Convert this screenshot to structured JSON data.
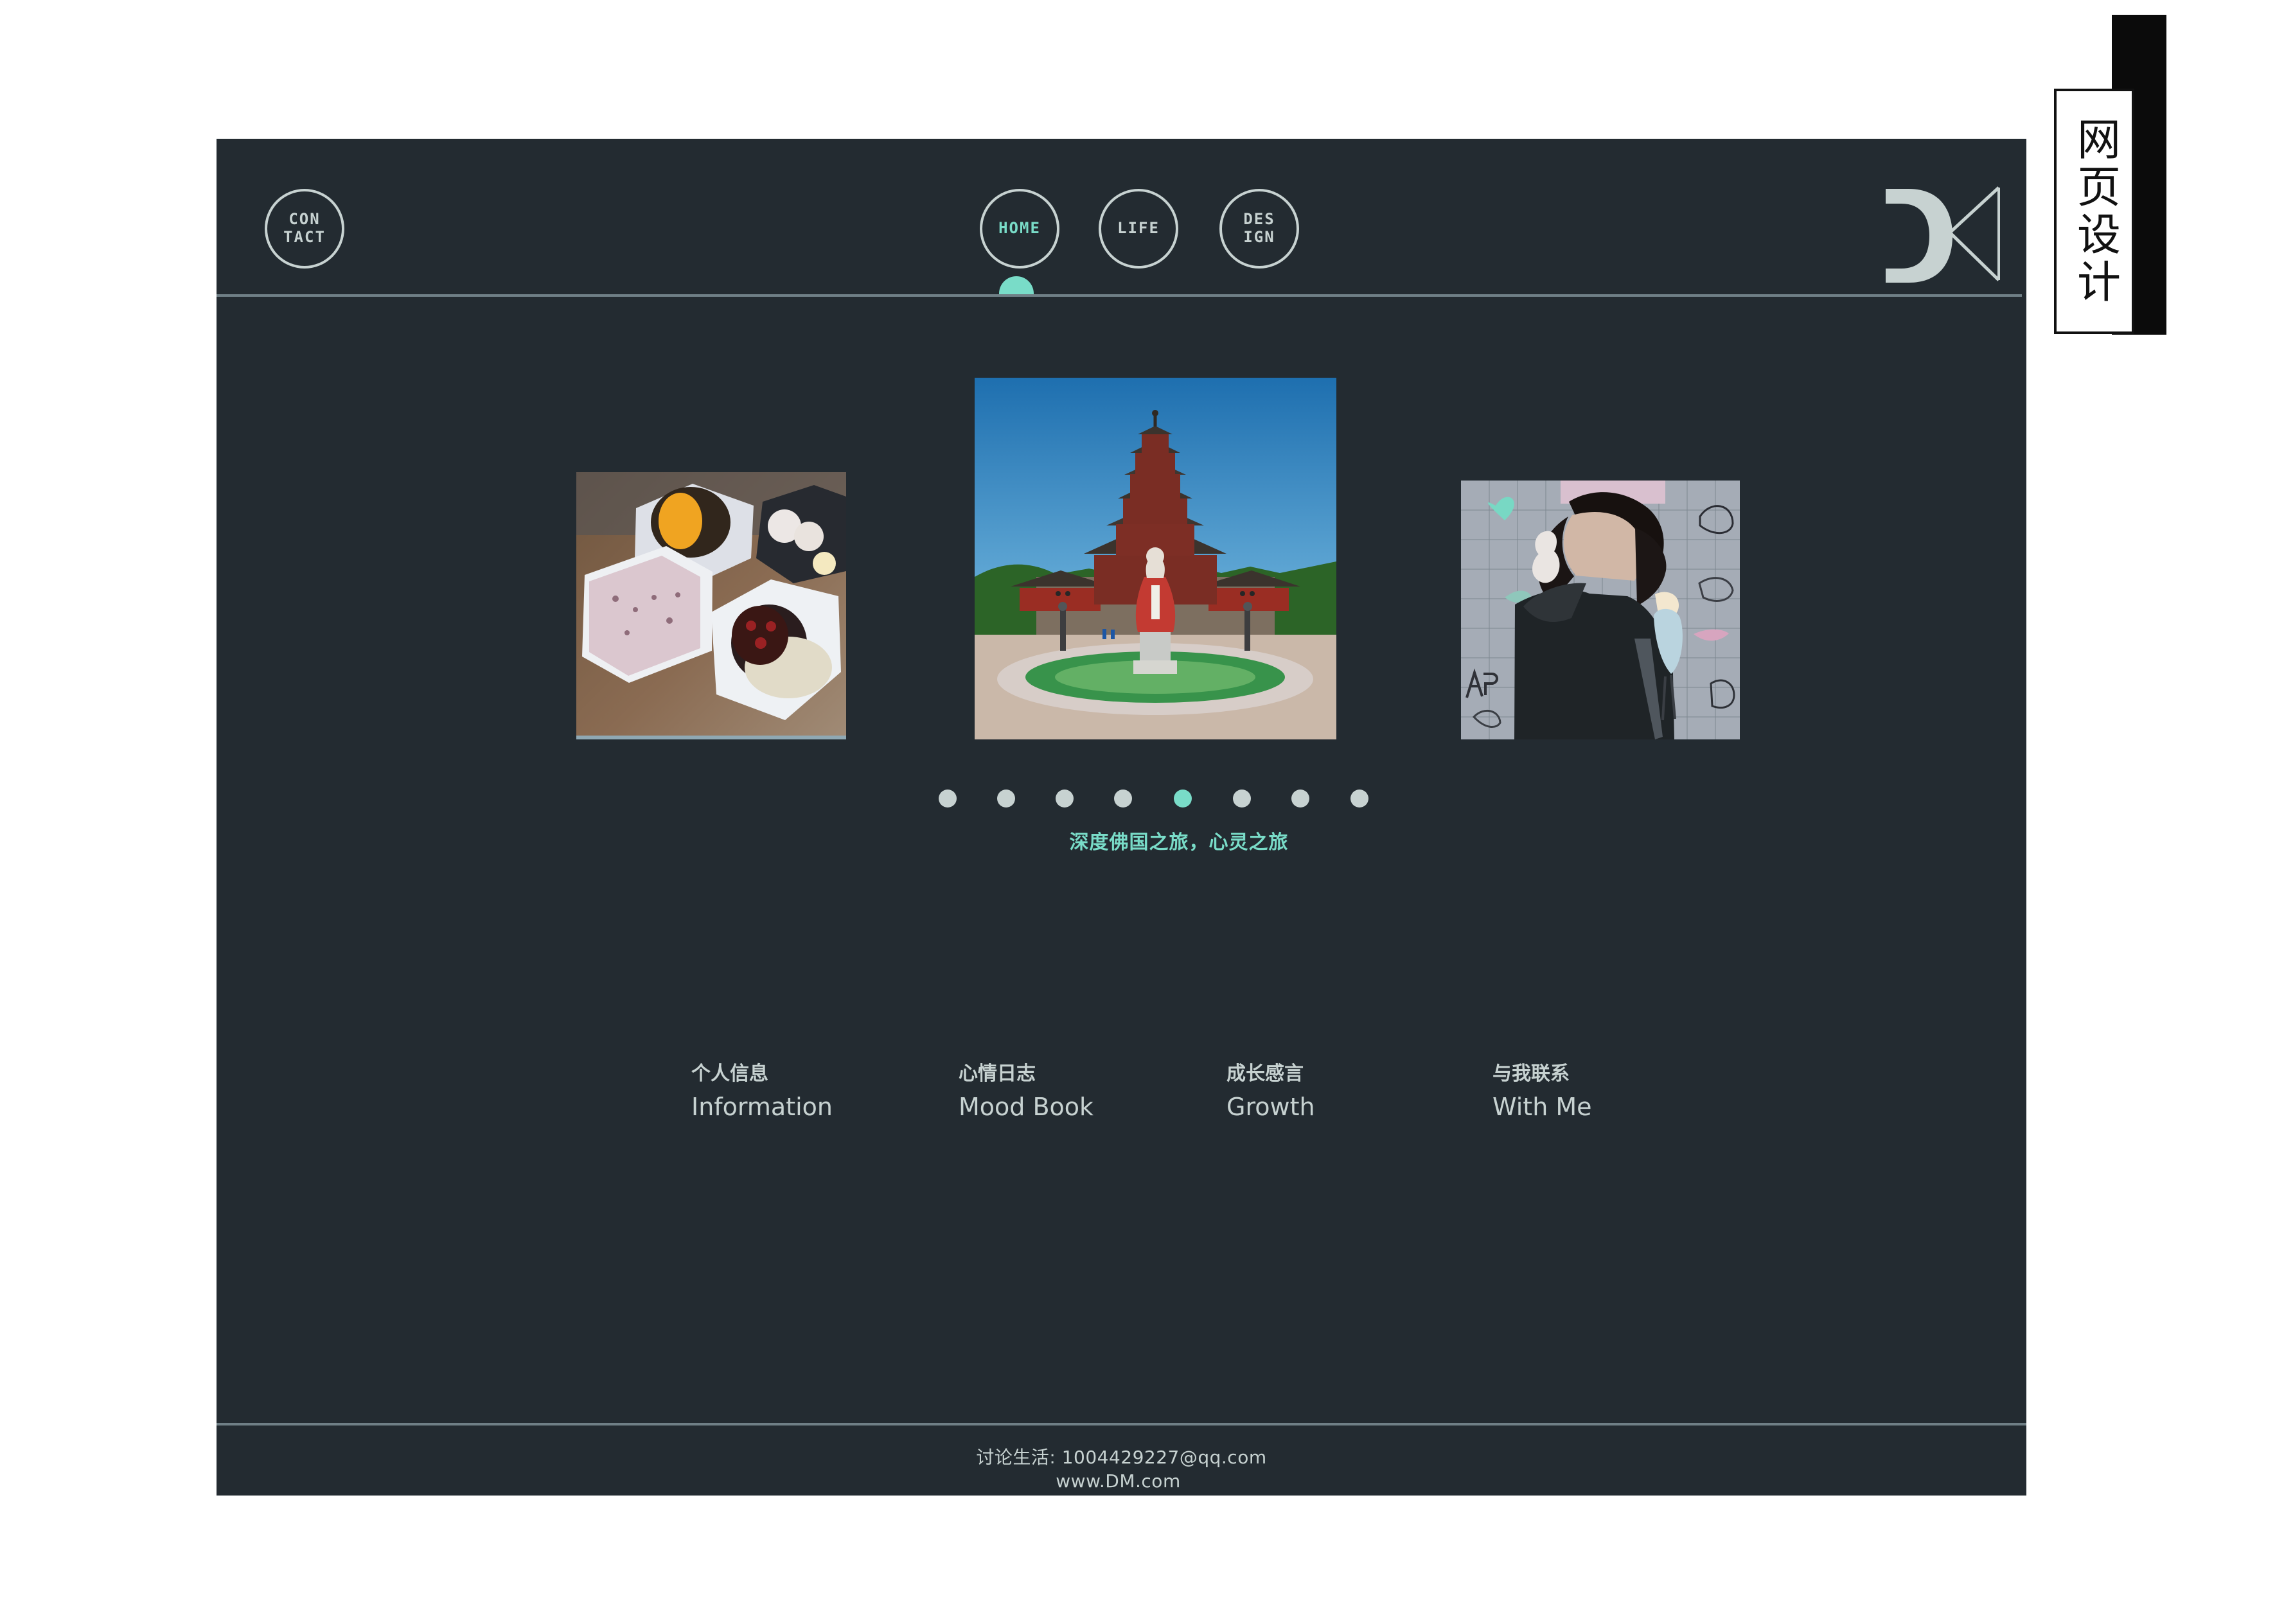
{
  "side_tag": {
    "text": "网页设计"
  },
  "header": {
    "contact_label": "CON\nTACT",
    "nav": {
      "home": "HOME",
      "life": "LIFE",
      "design": "DES\nIGN"
    },
    "active_tab": "home",
    "logo_text": "DK"
  },
  "gallery": {
    "caption": "深度佛国之旅，心灵之旅",
    "active_dot": 5,
    "dots_count": 8
  },
  "menu": {
    "items": [
      {
        "cn": "个人信息",
        "en": "Information"
      },
      {
        "cn": "心情日志",
        "en": "Mood Book"
      },
      {
        "cn": "成长感言",
        "en": "Growth"
      },
      {
        "cn": "与我联系",
        "en": "With Me"
      }
    ]
  },
  "footer": {
    "email_line": "讨论生活: 1004429227@qq.com",
    "site_line": "www.DM.com"
  },
  "colors": {
    "frame_bg": "#232b31",
    "accent": "#79dcc8",
    "text_light": "#c7d2d1",
    "line": "#6f7f86"
  },
  "icons": {
    "logo": "dk-logo-icon"
  }
}
